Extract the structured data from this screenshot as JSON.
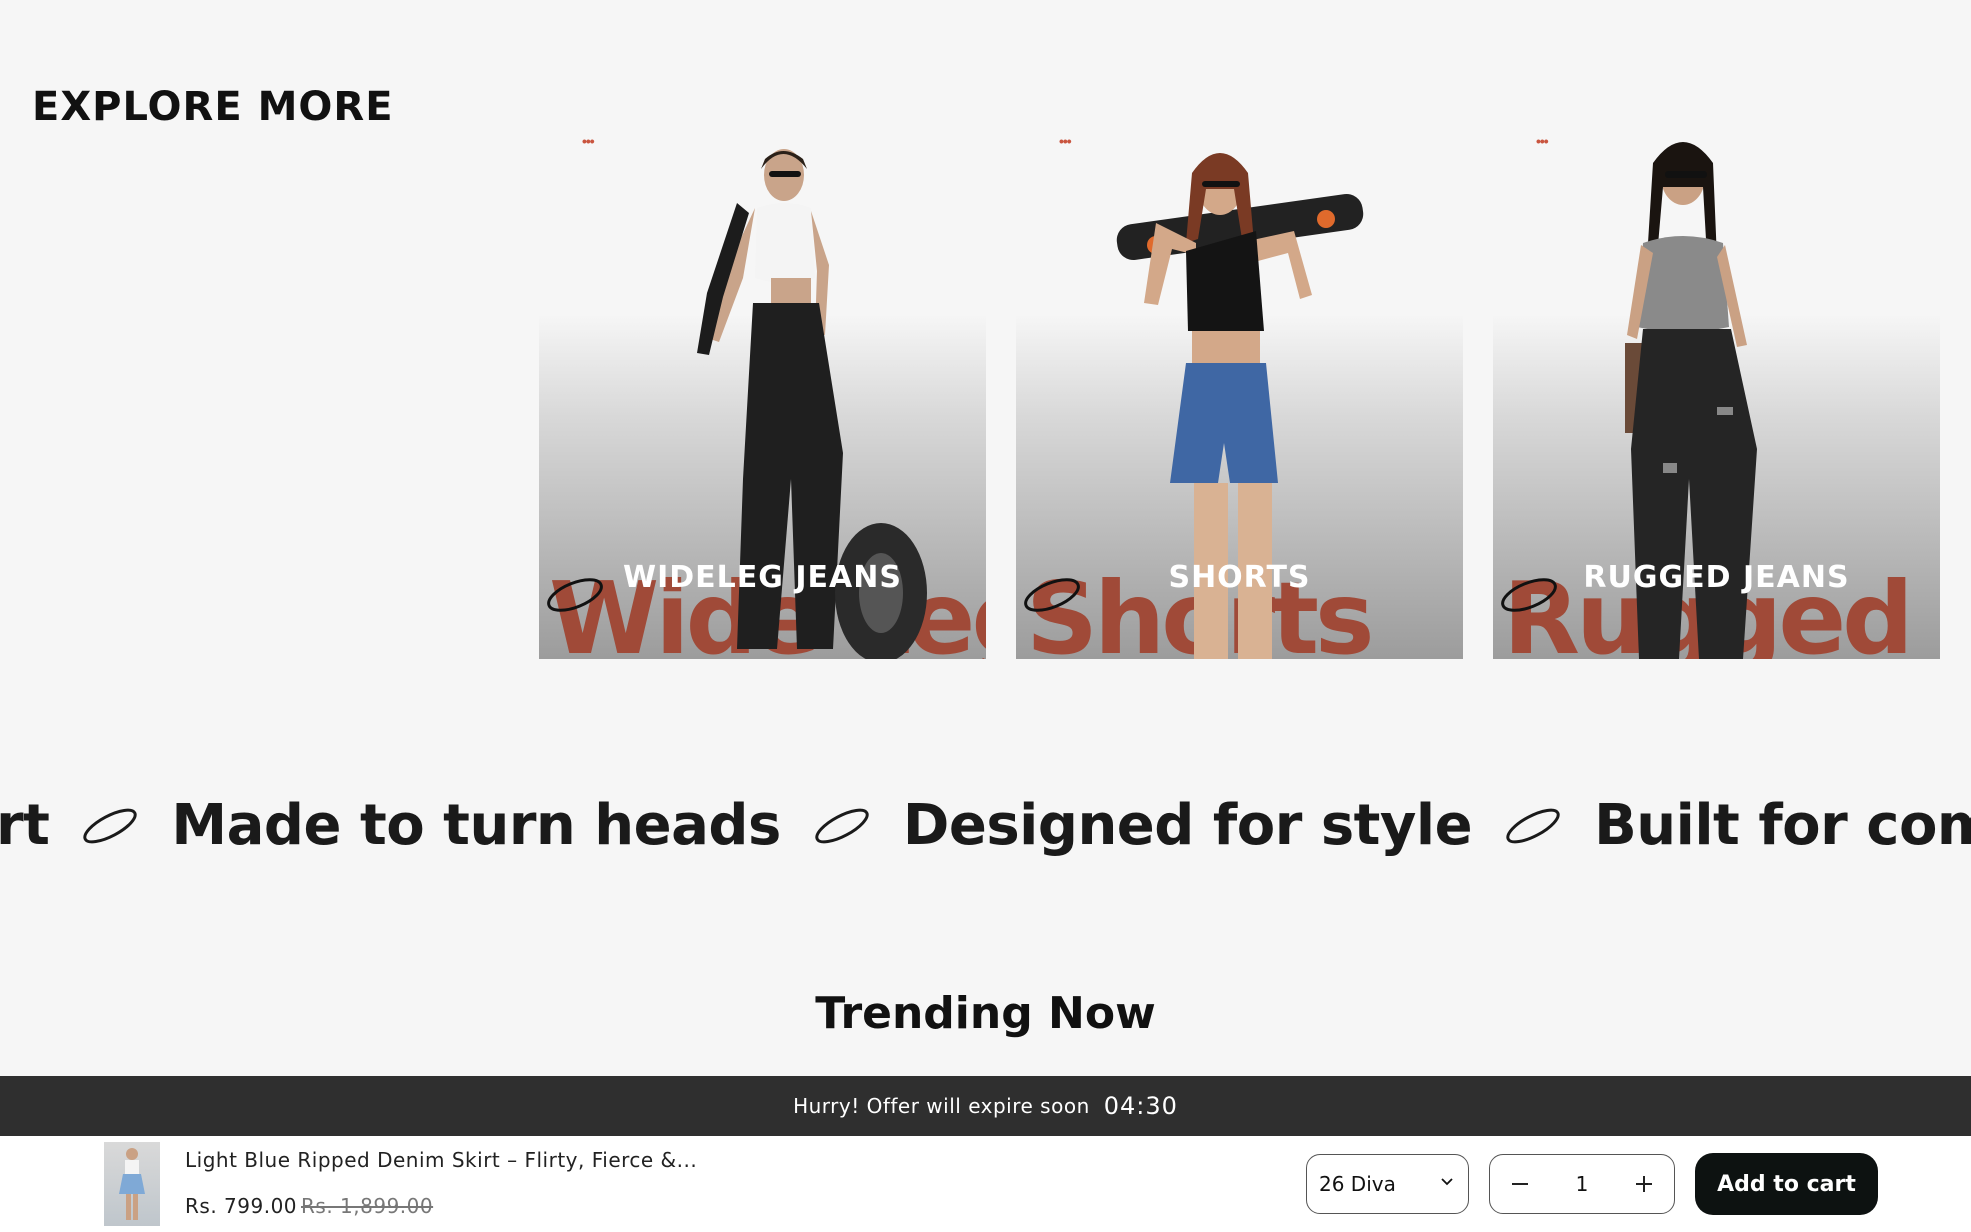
{
  "explore": {
    "title": "EXPLORE MORE"
  },
  "cards": [
    {
      "label": "WIDELEG JEANS",
      "bigword": "Wide Leg",
      "dots": "•••"
    },
    {
      "label": "SHORTS",
      "bigword": "Shorts",
      "dots": "•••"
    },
    {
      "label": "RUGGED JEANS",
      "bigword": "Rugged",
      "dots": "•••"
    }
  ],
  "marquee": {
    "phrases": [
      "ort",
      "Made to turn heads",
      "Designed for style",
      "Built for comfort"
    ]
  },
  "trending": {
    "title": "Trending Now"
  },
  "offer": {
    "text": "Hurry! Offer will expire soon",
    "timer": "04:30"
  },
  "sticky_cart": {
    "product_name": "Light Blue Ripped Denim Skirt – Flirty, Fierce &...",
    "price": "Rs. 799.00",
    "compare_price": "Rs. 1,899.00",
    "size_selected": "26 Diva",
    "quantity": "1",
    "add_to_cart_label": "Add to cart"
  },
  "colors": {
    "accent_dots": "#c9553f",
    "bigword": "#a04a38",
    "offer_bar": "#2f2f2f",
    "button_bg": "#0d1211"
  }
}
